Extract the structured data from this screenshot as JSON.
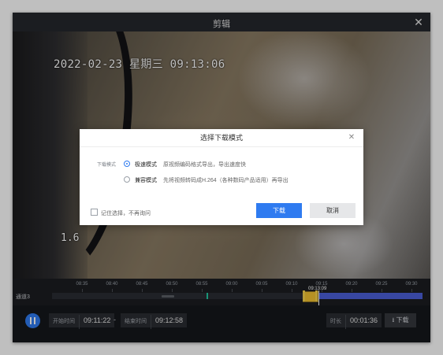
{
  "window": {
    "title": "剪辑",
    "close_glyph": "✕"
  },
  "video": {
    "osd_datetime": "2022-02-23 星期三 09:13:06",
    "osd_side_text": "1.6"
  },
  "timeline": {
    "ticks": [
      "08:35",
      "08:40",
      "08:45",
      "08:50",
      "08:55",
      "09:00",
      "09:05",
      "09:10",
      "09:15",
      "09:20",
      "09:25",
      "09:30"
    ],
    "track_label": "通道3",
    "playhead_time": "09:13:09"
  },
  "controls": {
    "start_label": "开始时间",
    "start_value": "09:11:22",
    "separator": "-",
    "end_label": "结束时间",
    "end_value": "09:12:58",
    "duration_label": "时长",
    "duration_value": "00:01:36",
    "download_label": "⭳ 下载"
  },
  "dialog": {
    "title": "选择下载模式",
    "close_glyph": "✕",
    "mode_label": "下载模式",
    "options": [
      {
        "name": "极速模式",
        "desc": "原视频编码格式导出，导出速度快",
        "selected": true
      },
      {
        "name": "兼容模式",
        "desc": "先将视频转码成H.264（各种数码产品适用）再导出",
        "selected": false
      }
    ],
    "remember_label": "记住选择，不再询问",
    "confirm_label": "下载",
    "cancel_label": "取消"
  },
  "colors": {
    "accent": "#2f7bf0",
    "selection": "#f2c230",
    "recorded_segment": "#4b5fd8",
    "event_marker": "#22c7a0"
  }
}
